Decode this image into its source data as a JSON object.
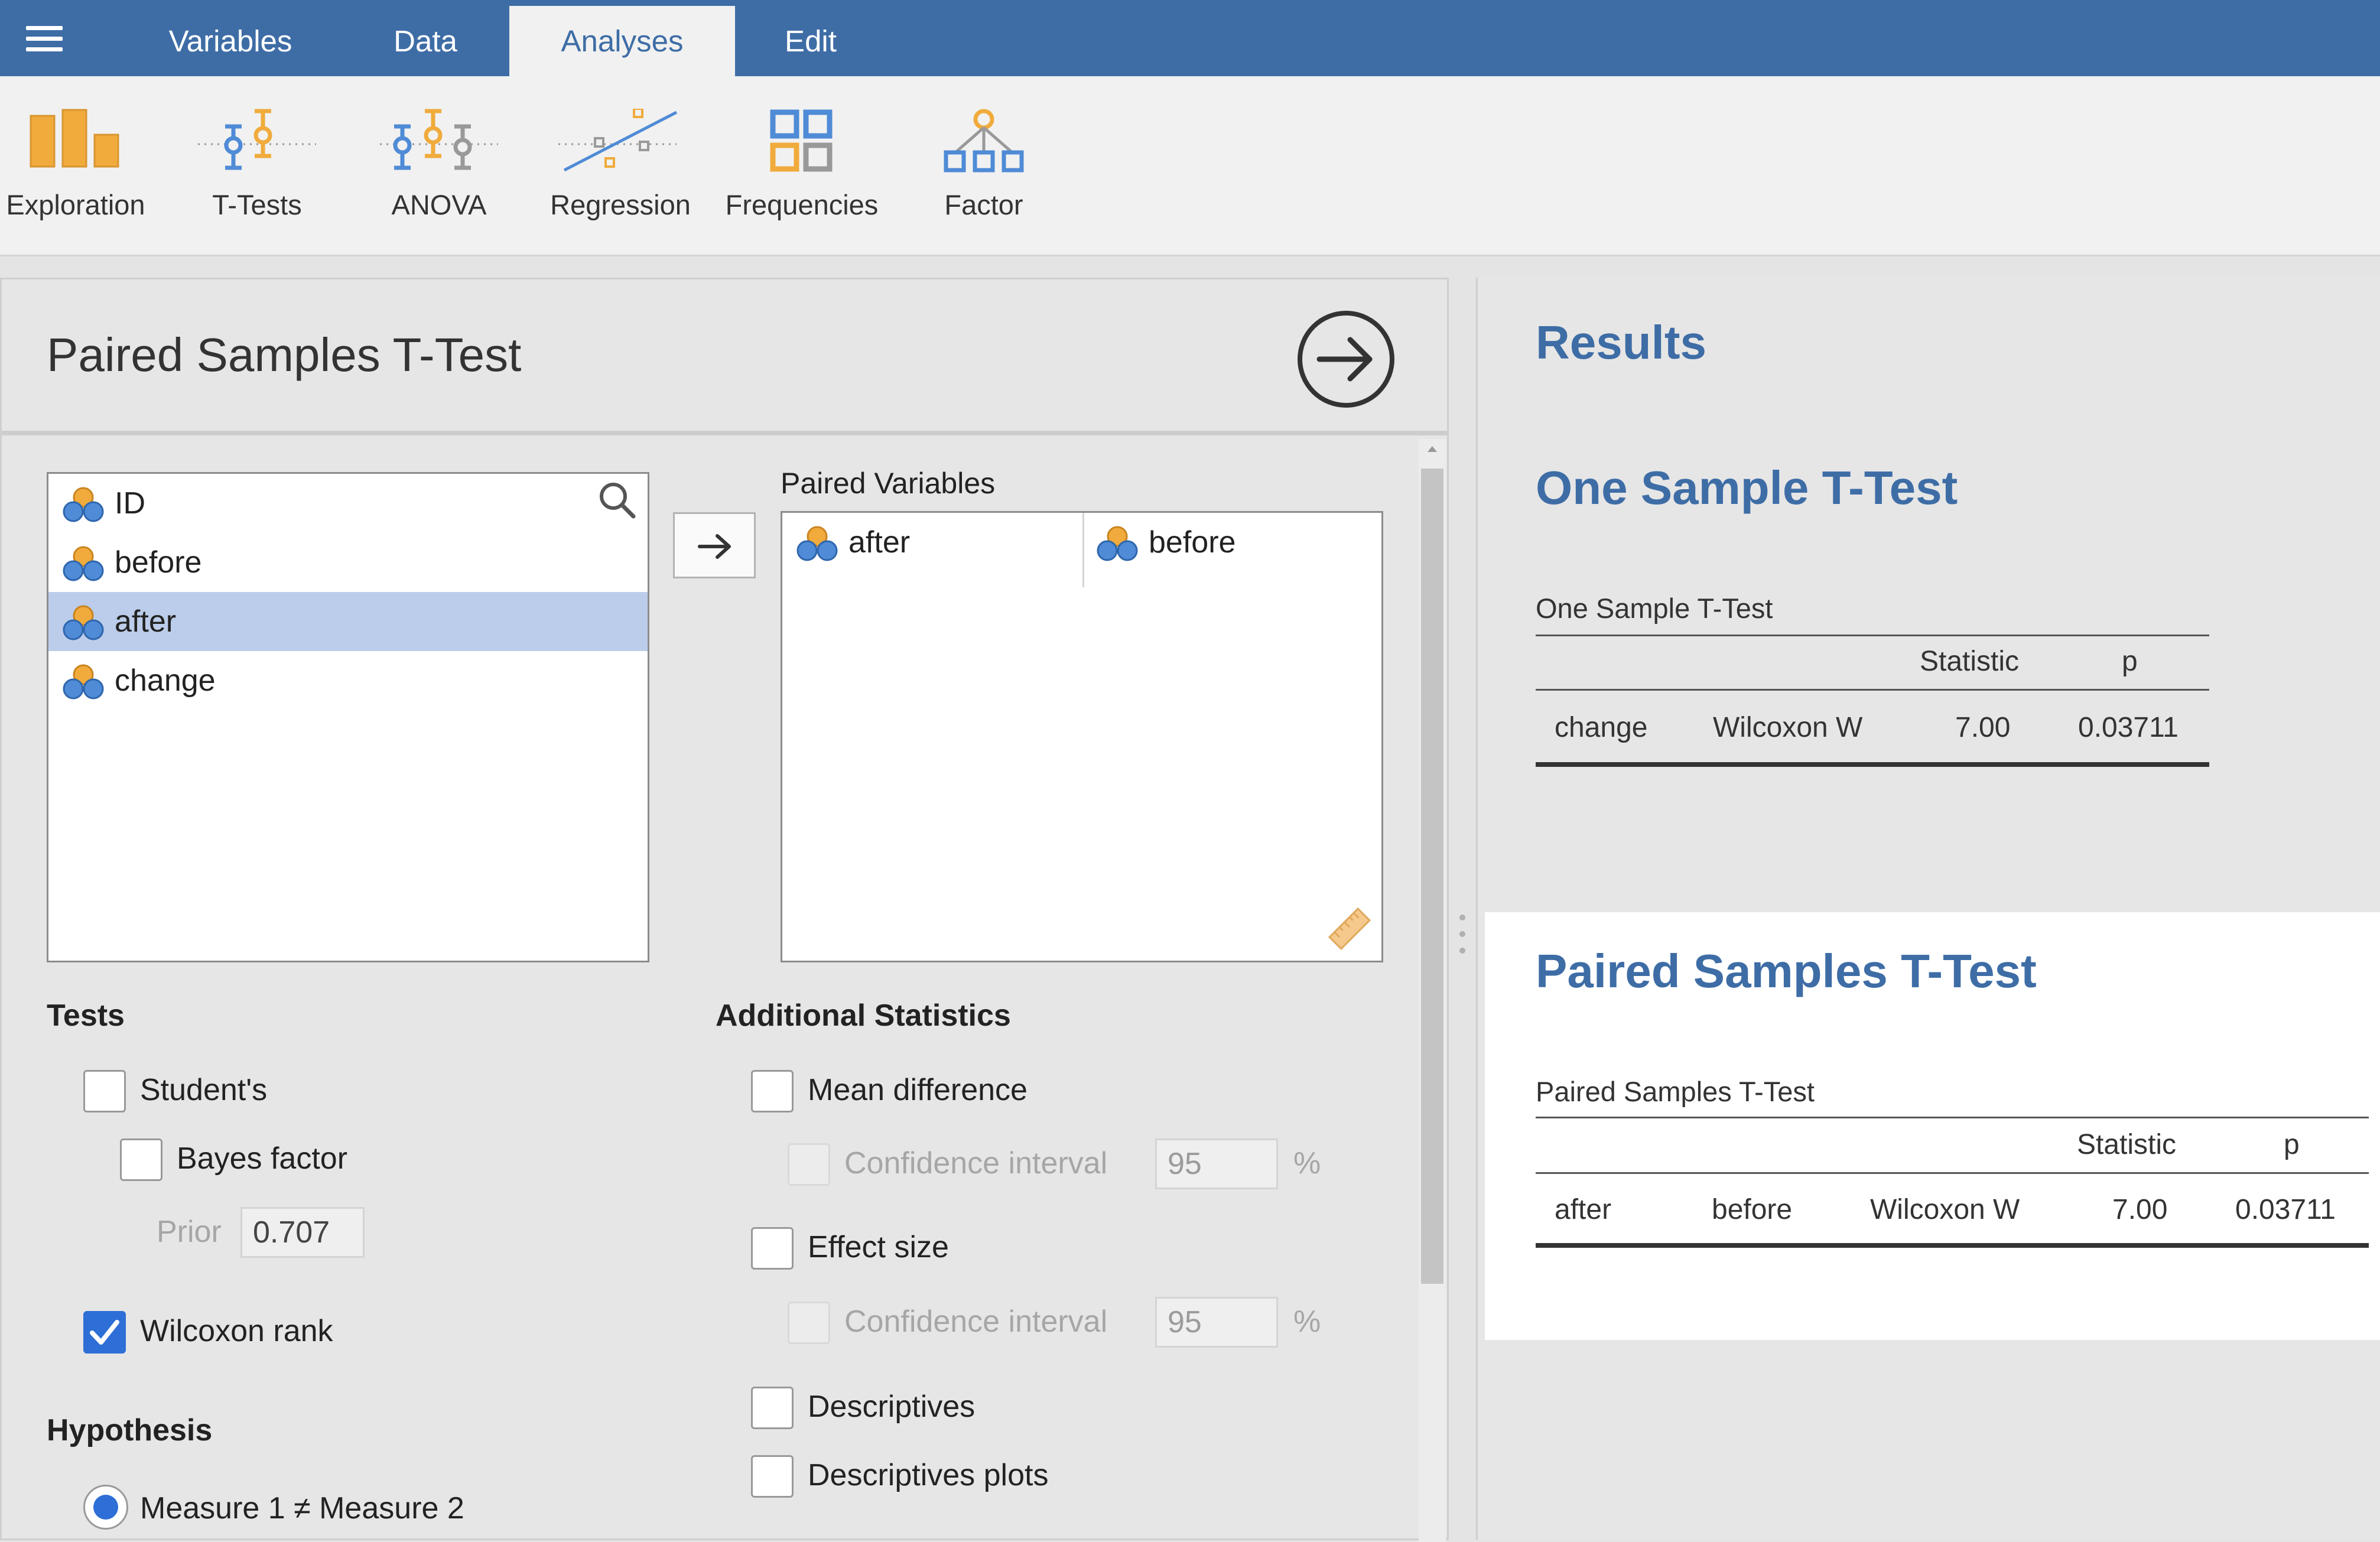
{
  "menu": {
    "tabs": [
      "Variables",
      "Data",
      "Analyses",
      "Edit"
    ],
    "active": "Analyses"
  },
  "ribbon": [
    "Exploration",
    "T-Tests",
    "ANOVA",
    "Regression",
    "Frequencies",
    "Factor"
  ],
  "colors": {
    "accent": "#3e6da6",
    "selection": "#bccdeb",
    "checked": "#2d6fd6",
    "orange": "#f0ab3c",
    "blue": "#4f8bd6"
  },
  "analysis": {
    "title": "Paired Samples T-Test"
  },
  "variables": [
    "ID",
    "before",
    "after",
    "change"
  ],
  "paired": {
    "label": "Paired Variables",
    "pair": [
      "after",
      "before"
    ]
  },
  "tests": {
    "heading": "Tests",
    "students": "Student's",
    "bayes": "Bayes factor",
    "prior_label": "Prior",
    "prior_value": "0.707",
    "wilcoxon": "Wilcoxon rank"
  },
  "additional": {
    "heading": "Additional Statistics",
    "mean_difference": "Mean difference",
    "ci_label": "Confidence interval",
    "ci_value": "95",
    "pct": "%",
    "effect_size": "Effect size",
    "ci2_value": "95",
    "descriptives": "Descriptives",
    "descriptives_plots": "Descriptives plots"
  },
  "hypothesis": {
    "heading": "Hypothesis",
    "option1": "Measure 1 ≠ Measure 2"
  },
  "results": {
    "heading": "Results",
    "one_sample": {
      "heading": "One Sample T-Test",
      "caption": "One Sample T-Test",
      "col_stat": "Statistic",
      "col_p": "p",
      "row": {
        "variable": "change",
        "test": "Wilcoxon W",
        "statistic": "7.00",
        "p": "0.03711"
      }
    },
    "paired": {
      "heading": "Paired Samples T-Test",
      "caption": "Paired Samples T-Test",
      "col_stat": "Statistic",
      "col_p": "p",
      "row": {
        "var1": "after",
        "var2": "before",
        "test": "Wilcoxon W",
        "statistic": "7.00",
        "p": "0.03711"
      }
    }
  }
}
